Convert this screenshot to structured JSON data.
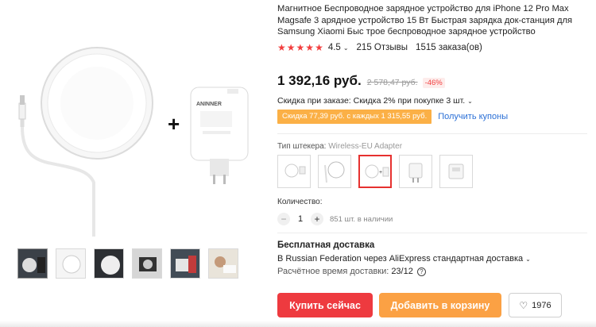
{
  "product": {
    "title": "Магнитное Беспроводное зарядное устройство для iPhone 12 Pro Max Magsafe 3 арядное устройство 15 Вт Быстрая зарядка док-станция для Samsung Xiaomi Быс трое беспроводное зарядное устройство",
    "rating": "4.5",
    "reviews": "215 Отзывы",
    "orders": "1515 заказа(ов)",
    "price": "1 392,16 руб.",
    "old_price": "2 578,47 руб.",
    "discount": "-46%",
    "order_discount": "Скидка при заказе: Скидка 2% при покупке 3 шт.",
    "coupon": "Скидка 77,39 руб. с каждых 1 315,55 руб.",
    "coupon_link": "Получить купоны"
  },
  "gallery": {
    "plus_sign": "+",
    "thumbnails": [
      "thumb-1",
      "thumb-2",
      "thumb-3",
      "thumb-4",
      "thumb-5",
      "thumb-6"
    ]
  },
  "plug": {
    "label": "Тип штекера:",
    "value": "Wireless-EU Adapter",
    "selected_index": 2
  },
  "quantity": {
    "label": "Количество:",
    "minus": "−",
    "value": "1",
    "plus": "+",
    "stock": "851 шт. в наличии"
  },
  "shipping": {
    "title": "Бесплатная доставка",
    "line": "В Russian Federation через AliExpress стандартная доставка",
    "eta_label": "Расчётное время доставки:",
    "eta_value": "23/12",
    "help": "?"
  },
  "actions": {
    "buy": "Купить сейчас",
    "cart": "Добавить в корзину",
    "wishlist_count": "1976"
  },
  "colors": {
    "accent_red": "#ee3a3f",
    "accent_orange": "#fba144",
    "star": "#f23e3e",
    "link": "#2a6fd6"
  }
}
